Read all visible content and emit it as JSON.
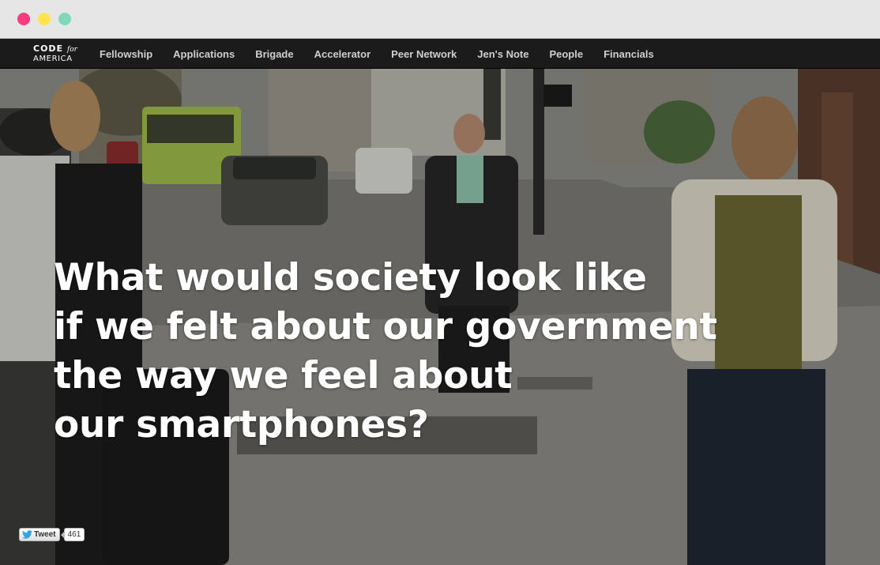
{
  "window": {
    "traffic_lights": [
      "#ff3b7f",
      "#ffe34d",
      "#7fd9b9"
    ]
  },
  "site": {
    "logo": {
      "line1": "CODE",
      "line1_script": "for",
      "line2": "AMERICA"
    },
    "nav": [
      {
        "label": "Fellowship"
      },
      {
        "label": "Applications"
      },
      {
        "label": "Brigade"
      },
      {
        "label": "Accelerator"
      },
      {
        "label": "Peer Network"
      },
      {
        "label": "Jen's Note"
      },
      {
        "label": "People"
      },
      {
        "label": "Financials"
      }
    ]
  },
  "hero": {
    "background": "street-photo",
    "headline_lines": [
      "What would society look like",
      "if we felt about our government",
      "the way we feel about",
      "our smartphones?"
    ]
  },
  "tweet": {
    "label": "Tweet",
    "count": "461",
    "icon": "twitter-bird-icon",
    "brand_color": "#2ca5e0"
  }
}
